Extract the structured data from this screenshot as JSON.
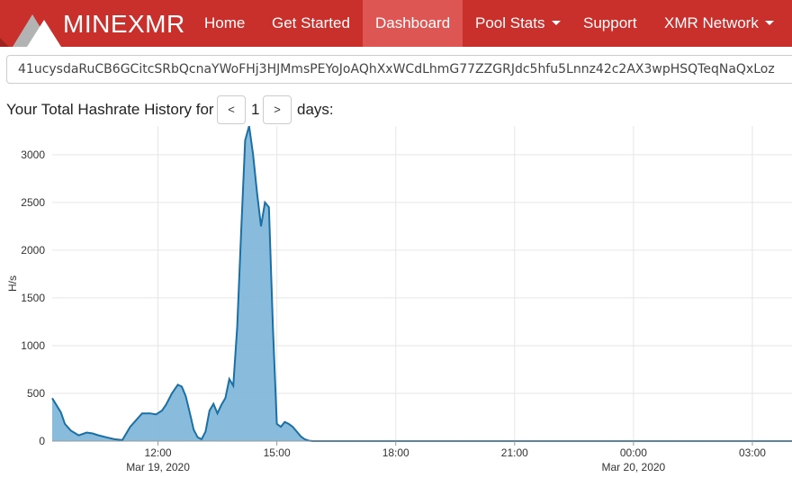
{
  "navbar": {
    "brand": "MINEXMR",
    "items": [
      {
        "label": "Home",
        "active": false,
        "dropdown": false
      },
      {
        "label": "Get Started",
        "active": false,
        "dropdown": false
      },
      {
        "label": "Dashboard",
        "active": true,
        "dropdown": false
      },
      {
        "label": "Pool Stats",
        "active": false,
        "dropdown": true
      },
      {
        "label": "Support",
        "active": false,
        "dropdown": false
      },
      {
        "label": "XMR Network",
        "active": false,
        "dropdown": true
      }
    ],
    "color": "#c9302c",
    "active_color": "#de5653"
  },
  "address": {
    "value": "41ucysdaRuCB6GCitcSRbQcnaYWoFHj3HJMmsPEYoJoAQhXxWCdLhmG77ZZGRJdc5hfu5Lnnz42c2AX3wpHSQTeqNaQxLoz"
  },
  "history": {
    "prefix": "Your Total Hashrate History for",
    "prev_label": "<",
    "days": "1",
    "next_label": ">",
    "suffix": "days:"
  },
  "chart_data": {
    "type": "area",
    "ylabel": "H/s",
    "ylim": [
      0,
      3300
    ],
    "yticks": [
      0,
      500,
      1000,
      1500,
      2000,
      2500,
      3000
    ],
    "x_unit": "hours since Mar 19, 2020 00:00",
    "xlim": [
      9.33,
      28.0
    ],
    "xticks": [
      {
        "x": 12,
        "label": "12:00",
        "sublabel": "Mar 19, 2020"
      },
      {
        "x": 15,
        "label": "15:00",
        "sublabel": ""
      },
      {
        "x": 18,
        "label": "18:00",
        "sublabel": ""
      },
      {
        "x": 21,
        "label": "21:00",
        "sublabel": ""
      },
      {
        "x": 24,
        "label": "00:00",
        "sublabel": "Mar 20, 2020"
      },
      {
        "x": 27,
        "label": "03:00",
        "sublabel": ""
      }
    ],
    "grid": true,
    "fill_color": "#7cb5d8",
    "line_color": "#1a6fa5",
    "series": [
      {
        "x": [
          9.33,
          9.55,
          9.65,
          9.8,
          10.0,
          10.2,
          10.35,
          10.5,
          10.7,
          10.9,
          11.1,
          11.3,
          11.6,
          11.8,
          11.95,
          12.1,
          12.2,
          12.35,
          12.5,
          12.6,
          12.7,
          12.8,
          12.9,
          13.0,
          13.1,
          13.2,
          13.3,
          13.4,
          13.5,
          13.6,
          13.7,
          13.8,
          13.9,
          14.0,
          14.1,
          14.2,
          14.3,
          14.4,
          14.5,
          14.6,
          14.7,
          14.8,
          14.9,
          15.0,
          15.1,
          15.2,
          15.3,
          15.4,
          15.5,
          15.6,
          15.7,
          15.8,
          15.9,
          16.0,
          16.1,
          16.2,
          16.4,
          16.6,
          28.0
        ],
        "y": [
          450,
          300,
          180,
          110,
          60,
          90,
          80,
          60,
          40,
          20,
          10,
          150,
          290,
          290,
          280,
          320,
          380,
          500,
          590,
          570,
          470,
          300,
          120,
          40,
          20,
          100,
          320,
          390,
          290,
          380,
          450,
          650,
          580,
          1200,
          2200,
          3150,
          3300,
          3000,
          2600,
          2250,
          2500,
          2450,
          1200,
          180,
          150,
          200,
          180,
          150,
          100,
          50,
          20,
          5,
          0,
          0,
          0,
          0,
          0,
          0,
          0
        ]
      }
    ]
  }
}
